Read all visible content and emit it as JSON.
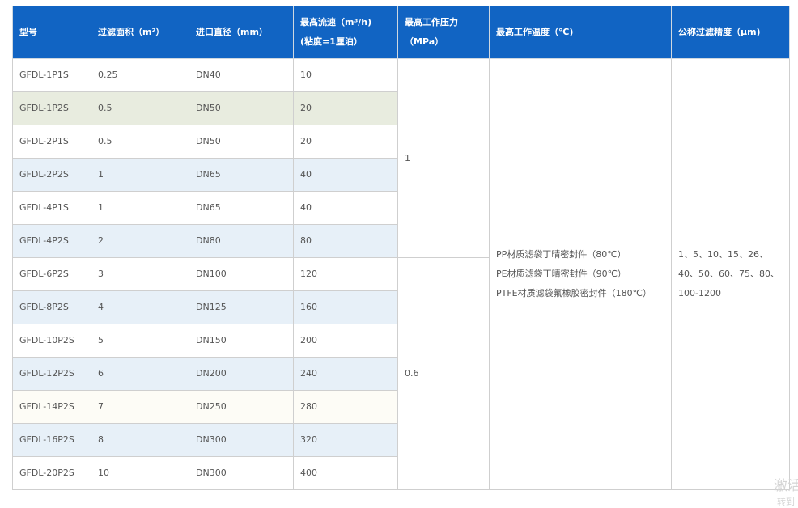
{
  "table": {
    "headers": [
      {
        "lines": [
          "型号"
        ]
      },
      {
        "lines": [
          "过滤面积（m²）"
        ]
      },
      {
        "lines": [
          "进口直径（mm）"
        ]
      },
      {
        "lines": [
          "最高流速（m³/h)",
          "(粘度=1厘泊）"
        ]
      },
      {
        "lines": [
          "最高工作压力",
          "（MPa）"
        ]
      },
      {
        "lines": [
          "最高工作温度（℃)"
        ]
      },
      {
        "lines": [
          "公称过滤精度（μm)"
        ]
      }
    ],
    "rows": [
      {
        "model": "GFDL-1P1S",
        "area": "0.25",
        "inlet": "DN40",
        "flow": "10",
        "bg": "white"
      },
      {
        "model": "GFDL-1P2S",
        "area": "0.5",
        "inlet": "DN50",
        "flow": "20",
        "bg": "green"
      },
      {
        "model": "GFDL-2P1S",
        "area": "0.5",
        "inlet": "DN50",
        "flow": "20",
        "bg": "white"
      },
      {
        "model": "GFDL-2P2S",
        "area": "1",
        "inlet": "DN65",
        "flow": "40",
        "bg": "blue"
      },
      {
        "model": "GFDL-4P1S",
        "area": "1",
        "inlet": "DN65",
        "flow": "40",
        "bg": "white"
      },
      {
        "model": "GFDL-4P2S",
        "area": "2",
        "inlet": "DN80",
        "flow": "80",
        "bg": "blue"
      },
      {
        "model": "GFDL-6P2S",
        "area": "3",
        "inlet": "DN100",
        "flow": "120",
        "bg": "white"
      },
      {
        "model": "GFDL-8P2S",
        "area": "4",
        "inlet": "DN125",
        "flow": "160",
        "bg": "blue"
      },
      {
        "model": "GFDL-10P2S",
        "area": "5",
        "inlet": "DN150",
        "flow": "200",
        "bg": "white"
      },
      {
        "model": "GFDL-12P2S",
        "area": "6",
        "inlet": "DN200",
        "flow": "240",
        "bg": "blue"
      },
      {
        "model": "GFDL-14P2S",
        "area": "7",
        "inlet": "DN250",
        "flow": "280",
        "bg": "cream"
      },
      {
        "model": "GFDL-16P2S",
        "area": "8",
        "inlet": "DN300",
        "flow": "320",
        "bg": "blue"
      },
      {
        "model": "GFDL-20P2S",
        "area": "10",
        "inlet": "DN300",
        "flow": "400",
        "bg": "white"
      }
    ],
    "pressure_groups": [
      {
        "value": "1",
        "rowspan": 6
      },
      {
        "value": "0.6",
        "rowspan": 7
      }
    ],
    "temperature": {
      "rowspan": 13,
      "lines": [
        "PP材质滤袋丁晴密封件（80℃）",
        "PE材质滤袋丁晴密封件（90℃）",
        "PTFE材质滤袋氟橡胶密封件（180℃）"
      ]
    },
    "precision": {
      "rowspan": 13,
      "lines": [
        "1、5、10、15、26、",
        "40、50、60、75、80、",
        "100-1200"
      ]
    }
  },
  "watermark": {
    "line1": "激活",
    "line2": "转到"
  },
  "colors": {
    "header_bg": "#1164c3",
    "header_text": "#ffffff",
    "row_green": "#e8ecdf",
    "row_blue": "#e7f0f8",
    "row_cream": "#fdfcf6",
    "border": "#cfcfcf"
  }
}
